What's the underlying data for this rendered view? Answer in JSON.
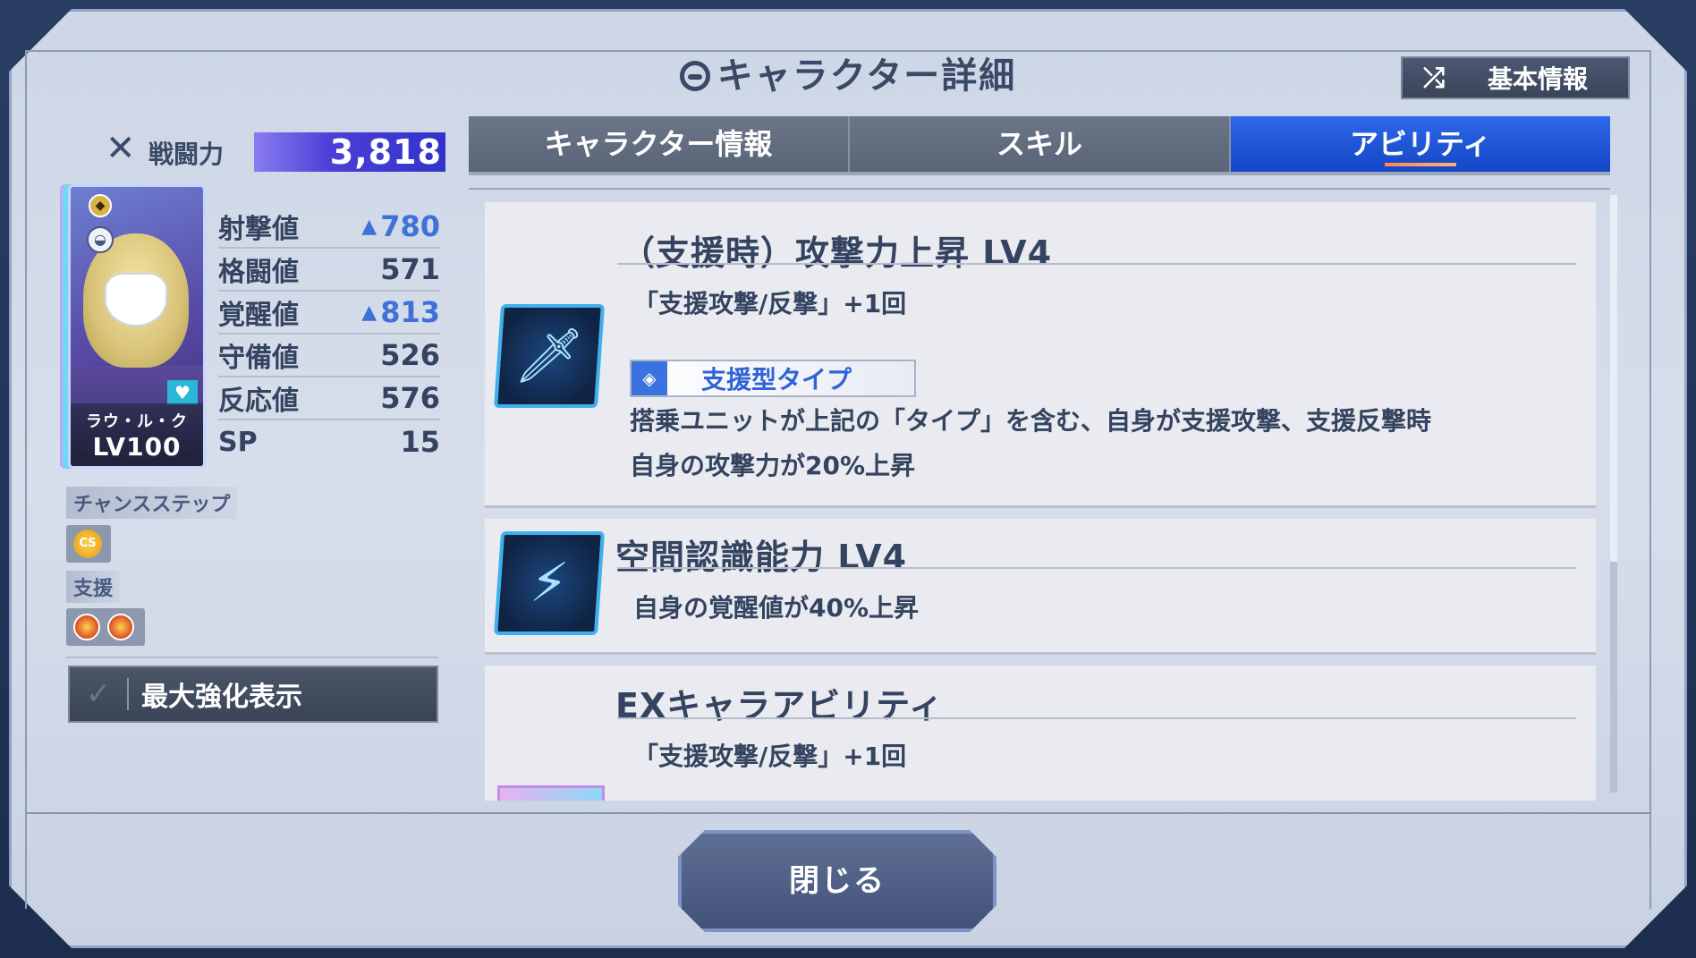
{
  "header": {
    "title": "キャラクター詳細",
    "basic_info_button": "基本情報"
  },
  "left": {
    "power_label": "戦闘力",
    "power_value": "3,818",
    "character": {
      "name": "ラウ・ル・ク",
      "level": "LV100"
    },
    "stats": [
      {
        "name": "射撃値",
        "value": "780",
        "boosted": true
      },
      {
        "name": "格闘値",
        "value": "571",
        "boosted": false
      },
      {
        "name": "覚醒値",
        "value": "813",
        "boosted": true
      },
      {
        "name": "守備値",
        "value": "526",
        "boosted": false
      },
      {
        "name": "反応値",
        "value": "576",
        "boosted": false
      },
      {
        "name": "SP",
        "value": "15",
        "boosted": false
      }
    ],
    "chance_step_label": "チャンスステップ",
    "cs_badge": "CS",
    "support_label": "支援",
    "max_enhance_label": "最大強化表示"
  },
  "tabs": [
    {
      "label": "キャラクター情報",
      "active": false
    },
    {
      "label": "スキル",
      "active": false
    },
    {
      "label": "アビリティ",
      "active": true
    }
  ],
  "abilities": [
    {
      "name": "（支援時）攻撃力上昇 LV4",
      "desc": "「支援攻撃/反撃」+1回",
      "type_tag": "支援型タイプ",
      "detail_1": "搭乗ユニットが上記の「タイプ」を含む、自身が支援攻撃、支援反撃時",
      "detail_2": "自身の攻撃力が20%上昇"
    },
    {
      "name": "空間認識能力 LV4",
      "desc": "自身の覚醒値が40%上昇"
    },
    {
      "name": "EXキャラアビリティ",
      "desc": "「支援攻撃/反撃」+1回"
    }
  ],
  "close_button": "閉じる",
  "colors": {
    "accent": "#1546c6",
    "boost": "#3e72d8",
    "panel": "#e9ebf0"
  }
}
